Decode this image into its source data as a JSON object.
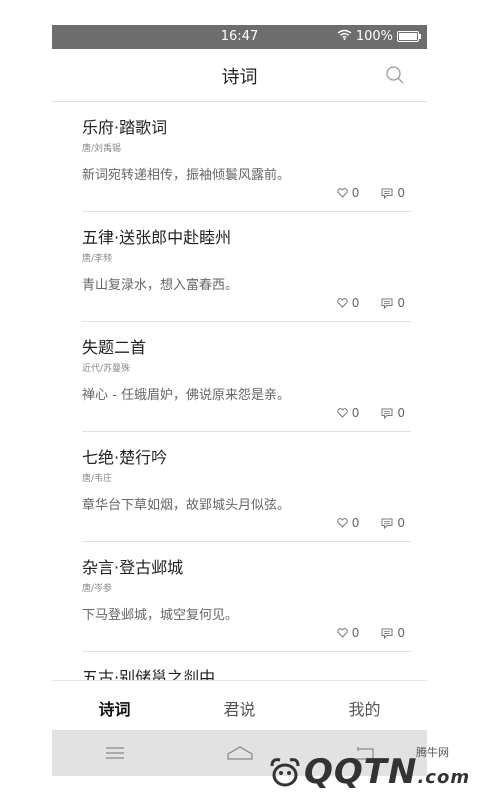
{
  "status": {
    "time": "16:47",
    "battery": "100%"
  },
  "header": {
    "title": "诗词"
  },
  "poems": [
    {
      "title": "乐府·踏歌词",
      "author": "唐/刘禹锡",
      "line": "新词宛转递相传，振袖倾鬟风露前。",
      "likes": "0",
      "comments": "0"
    },
    {
      "title": "五律·送张郎中赴睦州",
      "author": "唐/李频",
      "line": "青山复渌水，想入富春西。",
      "likes": "0",
      "comments": "0"
    },
    {
      "title": "失题二首",
      "author": "近代/苏曼殊",
      "line": "禅心 - 任蛾眉妒，佛说原来怨是亲。",
      "likes": "0",
      "comments": "0"
    },
    {
      "title": "七绝·楚行吟",
      "author": "唐/韦庄",
      "line": "章华台下草如烟，故郢城头月似弦。",
      "likes": "0",
      "comments": "0"
    },
    {
      "title": "杂言·登古邺城",
      "author": "唐/岑参",
      "line": "下马登邺城，城空复何见。",
      "likes": "0",
      "comments": "0"
    },
    {
      "title": "五古·别储邕之剡中",
      "author": "",
      "line": "",
      "likes": "",
      "comments": ""
    }
  ],
  "tabs": [
    {
      "label": "诗词",
      "active": true
    },
    {
      "label": "君说",
      "active": false
    },
    {
      "label": "我的",
      "active": false
    }
  ],
  "watermark": {
    "text": "腾牛网",
    "logo": "QQTN",
    "suffix": ".com"
  }
}
